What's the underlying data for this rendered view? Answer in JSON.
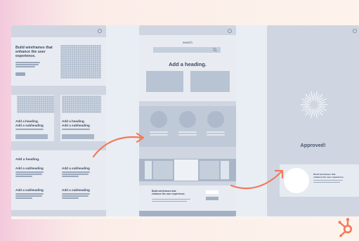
{
  "panel1": {
    "hero_title": "Build wireframes that\nenhance the user\nexperience.",
    "card_a_heading": "Add a heading.",
    "card_a_sub": "Add a subheading",
    "card_b_heading": "Add a heading.",
    "card_b_sub": "Add a subheading",
    "section_heading": "Add a heading.",
    "sub_1": "Add a subheading",
    "sub_2": "Add a subheading",
    "sub_3": "Add a subheading",
    "sub_4": "Add a subheading"
  },
  "panel2": {
    "search_label": "search",
    "heading": "Add a heading.",
    "footer_text": "Build wireframes that\nenhance the user experience."
  },
  "panel3": {
    "approved_label": "Approved!",
    "card_text": "Build wireframes that\nenhance the user experience."
  },
  "colors": {
    "arrow": "#f2795a",
    "hubspot_logo": "#f2795a"
  },
  "icons": {
    "search": "magnifier-icon",
    "logo": "hubspot-sprocket-icon"
  }
}
